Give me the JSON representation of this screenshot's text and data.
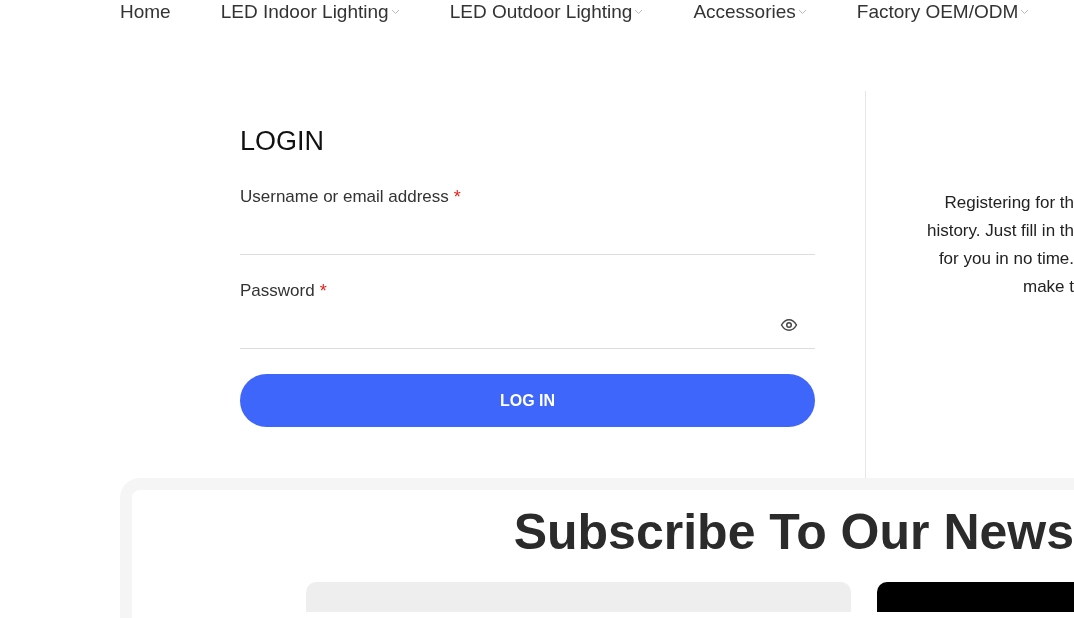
{
  "nav": {
    "items": [
      {
        "label": "Home",
        "dropdown": false
      },
      {
        "label": "LED Indoor Lighting",
        "dropdown": true
      },
      {
        "label": "LED Outdoor Lighting",
        "dropdown": true
      },
      {
        "label": "Accessories",
        "dropdown": true
      },
      {
        "label": "Factory OEM/ODM",
        "dropdown": true
      }
    ]
  },
  "login": {
    "title": "LOGIN",
    "fields": [
      {
        "label": "Username or email address",
        "required_mark": "*",
        "kind": "text"
      },
      {
        "label": "Password",
        "required_mark": "*",
        "kind": "password"
      }
    ],
    "button": "LOG IN"
  },
  "register": {
    "lines": [
      "Registering for th",
      "history. Just fill in th",
      "for you in no time.",
      "make t"
    ]
  },
  "newsletter": {
    "title": "Subscribe To Our News"
  }
}
